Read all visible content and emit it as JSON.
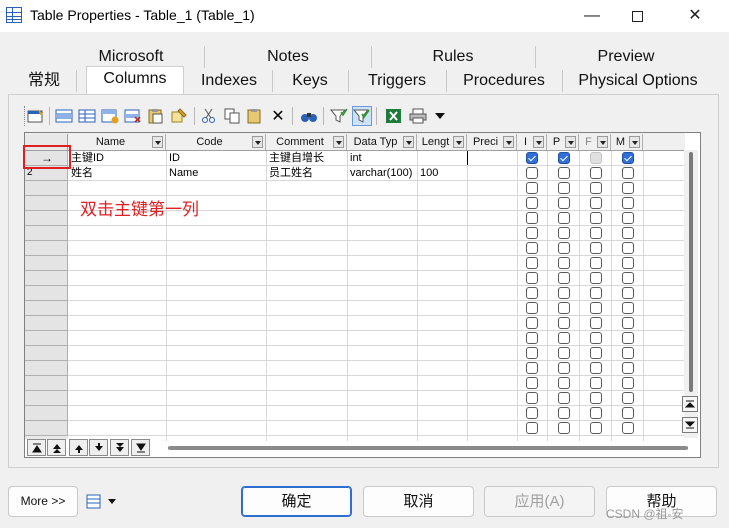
{
  "window": {
    "title": "Table Properties - Table_1 (Table_1)",
    "minimize_glyph": "—",
    "close_glyph": "✕"
  },
  "tabs_top": [
    "Microsoft",
    "Notes",
    "Rules",
    "Preview"
  ],
  "tabs_bottom": [
    "常规",
    "Columns",
    "Indexes",
    "Keys",
    "Triggers",
    "Procedures",
    "Physical Options"
  ],
  "active_tab": "Columns",
  "toolbar_icons": [
    "properties-icon",
    "add-row-icon",
    "insert-row-icon",
    "add-rows-icon",
    "delete-rows-icon",
    "paste-icon",
    "rename-icon",
    "cut-icon",
    "copy-icon",
    "paste-clipboard-icon",
    "delete-icon",
    "find-icon",
    "filter-icon",
    "customize-columns-icon",
    "export-excel-icon",
    "print-icon",
    "dropdown-icon"
  ],
  "grid": {
    "columns": [
      "Name",
      "Code",
      "Comment",
      "Data Typ",
      "Lengt",
      "Preci",
      "I",
      "P",
      "F",
      "M"
    ],
    "rows": [
      {
        "marker": "→",
        "name": "主键ID",
        "code": "ID",
        "comment": "主键自增长",
        "data_type": "int",
        "length": "",
        "precision": "",
        "I": true,
        "P": true,
        "F": false,
        "M": true
      },
      {
        "marker": "2",
        "name": "姓名",
        "code": "Name",
        "comment": "员工姓名",
        "data_type": "varchar(100)",
        "length": "100",
        "precision": "",
        "I": false,
        "P": false,
        "F": false,
        "M": false
      }
    ],
    "empty_row_count": 17
  },
  "annotation": "双击主键第一列",
  "footer": {
    "more_button": "More >>",
    "ok_button": "确定",
    "cancel_button": "取消",
    "apply_button": "应用(A)",
    "help_button": "帮助"
  },
  "watermark": "CSDN @祖-安",
  "colors": {
    "accent": "#2e6dd1",
    "annotation": "#e02020"
  }
}
